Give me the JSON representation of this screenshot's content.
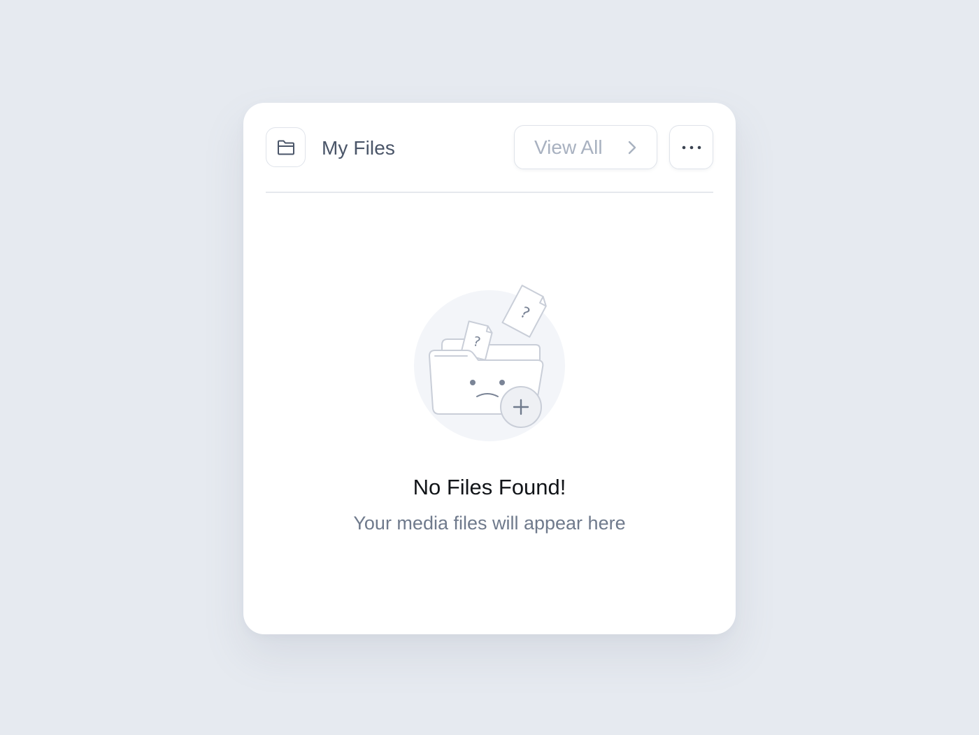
{
  "card": {
    "title": "My Files",
    "folder_icon": "folder-icon",
    "view_all_label": "View All",
    "view_all_icon": "chevron-right-icon",
    "more_icon": "ellipsis-horizontal-icon"
  },
  "empty_state": {
    "illustration": "sad-folder-illustration",
    "question_mark": "?",
    "title": "No Files Found!",
    "subtitle": "Your media files will appear here"
  },
  "colors": {
    "background": "#e6eaf0",
    "card": "#ffffff",
    "border": "#dfe3ea",
    "muted_text": "#a8b1c0",
    "title_text": "#4a5568",
    "heading_text": "#111418",
    "subtitle_text": "#6f7a8c"
  }
}
